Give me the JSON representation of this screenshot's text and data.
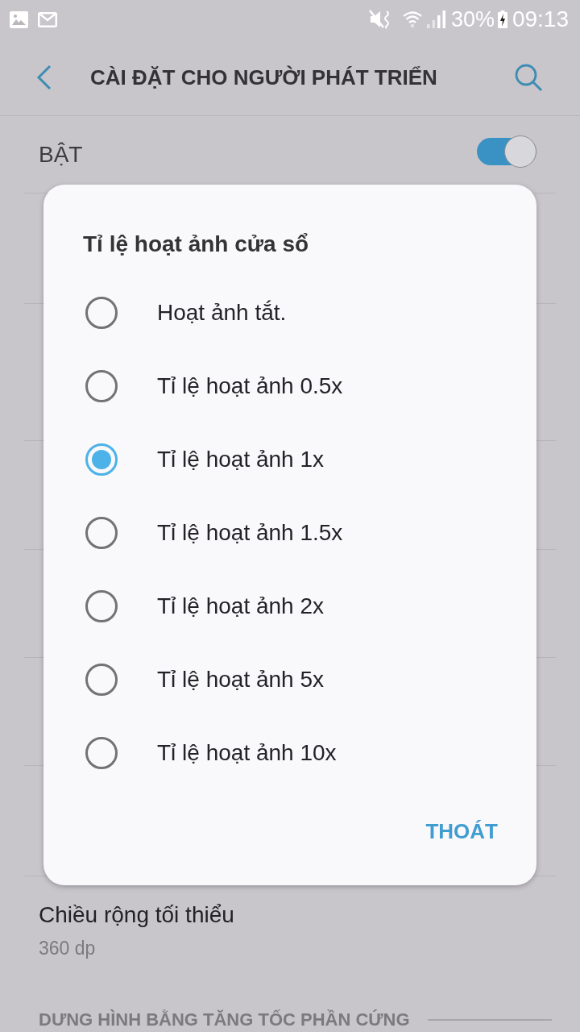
{
  "status_bar": {
    "battery": "30%",
    "time": "09:13"
  },
  "header": {
    "title": "CÀI ĐẶT CHO NGƯỜI PHÁT TRIỂN"
  },
  "master_switch": {
    "label": "BẬT",
    "on": true
  },
  "settings": [
    {
      "title": "Chiều rộng tối thiểu",
      "value": "360 dp"
    }
  ],
  "section_header": {
    "title": "DƯNG HÌNH BẰNG TĂNG TỐC PHẦN CỨNG"
  },
  "dialog": {
    "title": "Tỉ lệ hoạt ảnh cửa sổ",
    "options": [
      {
        "label": "Hoạt ảnh tắt.",
        "selected": false
      },
      {
        "label": "Tỉ lệ hoạt ảnh 0.5x",
        "selected": false
      },
      {
        "label": "Tỉ lệ hoạt ảnh 1x",
        "selected": true
      },
      {
        "label": "Tỉ lệ hoạt ảnh 1.5x",
        "selected": false
      },
      {
        "label": "Tỉ lệ hoạt ảnh 2x",
        "selected": false
      },
      {
        "label": "Tỉ lệ hoạt ảnh 5x",
        "selected": false
      },
      {
        "label": "Tỉ lệ hoạt ảnh 10x",
        "selected": false
      }
    ],
    "button": "THOÁT"
  }
}
